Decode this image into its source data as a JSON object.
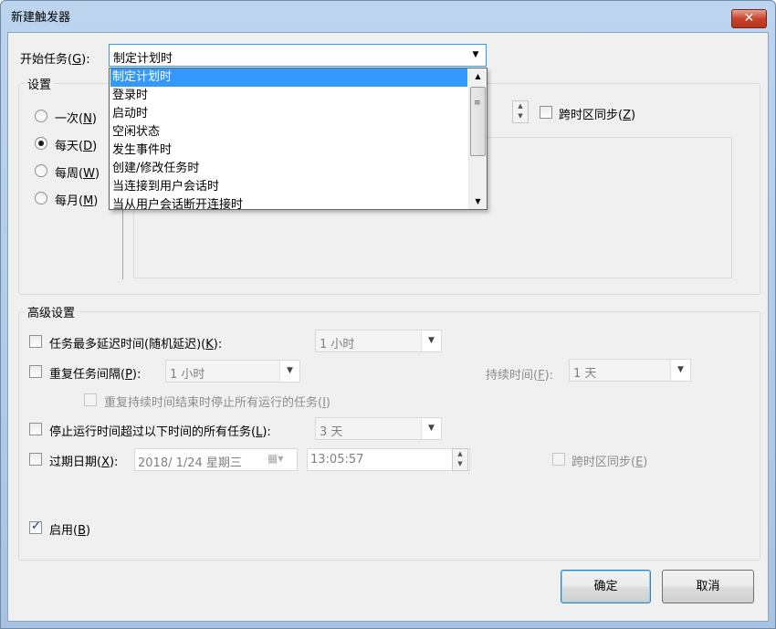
{
  "window": {
    "title": "新建触发器",
    "close_symbol": "✕"
  },
  "start_task": {
    "label": "开始任务(",
    "accel": "G",
    "label_end": "):",
    "selected": "制定计划时",
    "options": [
      "制定计划时",
      "登录时",
      "启动时",
      "空闲状态",
      "发生事件时",
      "创建/修改任务时",
      "当连接到用户会话时",
      "当从用户会话断开连接时"
    ]
  },
  "settings": {
    "title": "设置",
    "radios": [
      {
        "label": "一次(",
        "accel": "N",
        "end": ")",
        "checked": false
      },
      {
        "label": "每天(",
        "accel": "D",
        "end": ")",
        "checked": true
      },
      {
        "label": "每周(",
        "accel": "W",
        "end": ")",
        "checked": false
      },
      {
        "label": "每月(",
        "accel": "M",
        "end": ")",
        "checked": false
      }
    ],
    "sync_tz": {
      "label": "跨时区同步(",
      "accel": "Z",
      "end": ")",
      "checked": false
    }
  },
  "advanced": {
    "title": "高级设置",
    "delay": {
      "label": "任务最多延迟时间(随机延迟)(",
      "accel": "K",
      "end": "):",
      "value": "1 小时",
      "checked": false
    },
    "repeat": {
      "label": "重复任务间隔(",
      "accel": "P",
      "end": "):",
      "value": "1 小时",
      "checked": false,
      "duration_label": "持续时间(",
      "duration_accel": "F",
      "duration_end": "):",
      "duration_value": "1 天"
    },
    "stop_at_end": {
      "label": "重复持续时间结束时停止所有运行的任务(",
      "accel": "I",
      "end": ")",
      "checked": false
    },
    "stop_longer": {
      "label": "停止运行时间超过以下时间的所有任务(",
      "accel": "L",
      "end": "):",
      "value": "3 天",
      "checked": false
    },
    "expire": {
      "label": "过期日期(",
      "accel": "X",
      "end": "):",
      "checked": false,
      "date": "2018/  1/24 星期三",
      "time": "13:05:57",
      "sync_label": "跨时区同步(",
      "sync_accel": "E",
      "sync_end": ")"
    },
    "enabled": {
      "label": "启用(",
      "accel": "B",
      "end": ")",
      "checked": true
    }
  },
  "buttons": {
    "ok": "确定",
    "cancel": "取消"
  }
}
